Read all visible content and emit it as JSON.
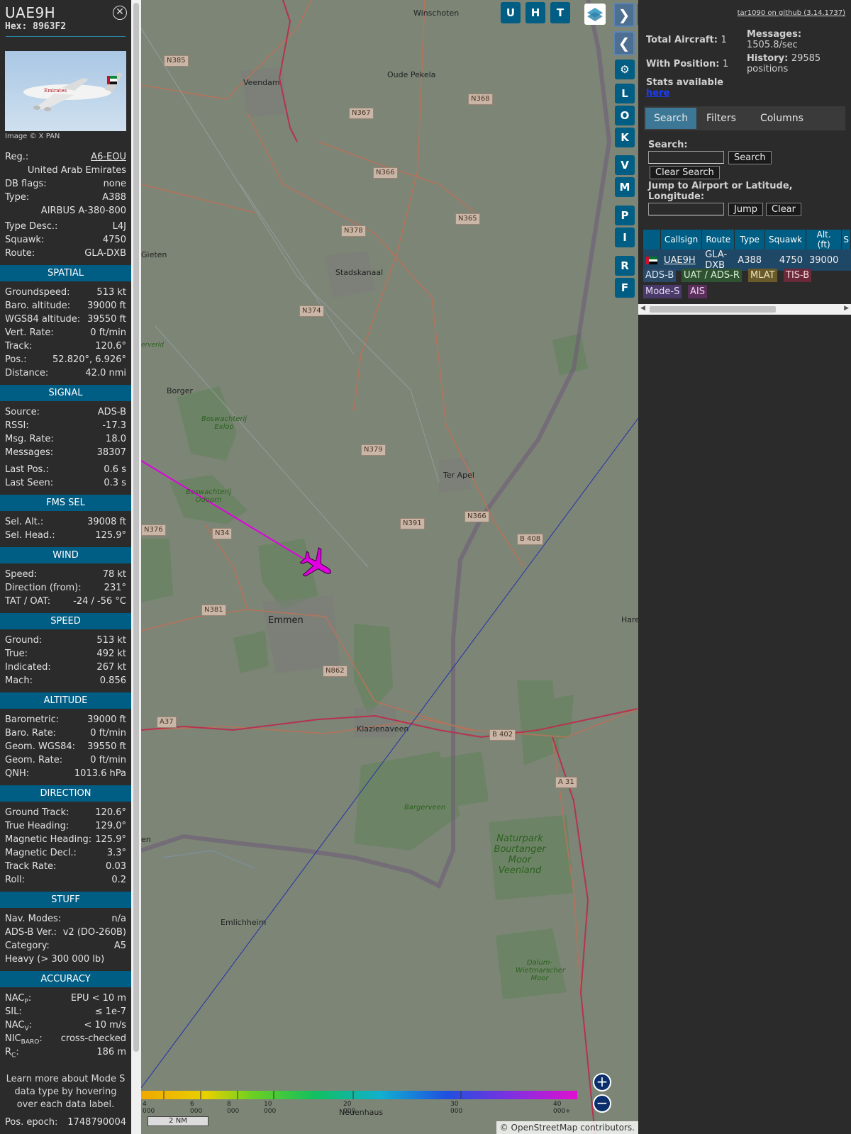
{
  "aircraft": {
    "callsign": "UAE9H",
    "hex_label": "Hex:",
    "hex": "8963F2",
    "image_credit": "Image © X PAN",
    "reg_label": "Reg.:",
    "reg": "A6-EOU",
    "country": "United Arab Emirates",
    "dbflags_label": "DB flags:",
    "dbflags": "none",
    "type_label": "Type:",
    "type": "A388",
    "type_full": "AIRBUS A-380-800",
    "typedesc_label": "Type Desc.:",
    "typedesc": "L4J",
    "squawk_label": "Squawk:",
    "squawk": "4750",
    "route_label": "Route:",
    "route": "GLA-DXB"
  },
  "sections": {
    "spatial": {
      "title": "SPATIAL",
      "rows": [
        {
          "l": "Groundspeed:",
          "v": "513 kt"
        },
        {
          "l": "Baro. altitude:",
          "v": "39000 ft"
        },
        {
          "l": "WGS84 altitude:",
          "v": "39550 ft"
        },
        {
          "l": "Vert. Rate:",
          "v": "0 ft/min"
        },
        {
          "l": "Track:",
          "v": "120.6°"
        },
        {
          "l": "Pos.:",
          "v": "52.820°, 6.926°"
        },
        {
          "l": "Distance:",
          "v": "42.0 nmi"
        }
      ]
    },
    "signal": {
      "title": "SIGNAL",
      "rows": [
        {
          "l": "Source:",
          "v": "ADS-B"
        },
        {
          "l": "RSSI:",
          "v": "-17.3"
        },
        {
          "l": "Msg. Rate:",
          "v": "18.0"
        },
        {
          "l": "Messages:",
          "v": "38307"
        },
        {
          "l": "Last Pos.:",
          "v": "0.6 s"
        },
        {
          "l": "Last Seen:",
          "v": "0.3 s"
        }
      ]
    },
    "fms": {
      "title": "FMS SEL",
      "rows": [
        {
          "l": "Sel. Alt.:",
          "v": "39008 ft"
        },
        {
          "l": "Sel. Head.:",
          "v": "125.9°"
        }
      ]
    },
    "wind": {
      "title": "WIND",
      "rows": [
        {
          "l": "Speed:",
          "v": "78 kt"
        },
        {
          "l": "Direction (from):",
          "v": "231°"
        },
        {
          "l": "TAT / OAT:",
          "v": "-24 / -56 °C"
        }
      ]
    },
    "speed": {
      "title": "SPEED",
      "rows": [
        {
          "l": "Ground:",
          "v": "513 kt"
        },
        {
          "l": "True:",
          "v": "492 kt"
        },
        {
          "l": "Indicated:",
          "v": "267 kt"
        },
        {
          "l": "Mach:",
          "v": "0.856"
        }
      ]
    },
    "altitude": {
      "title": "ALTITUDE",
      "rows": [
        {
          "l": "Barometric:",
          "v": "39000 ft"
        },
        {
          "l": "Baro. Rate:",
          "v": "0 ft/min"
        },
        {
          "l": "Geom. WGS84:",
          "v": "39550 ft"
        },
        {
          "l": "Geom. Rate:",
          "v": "0 ft/min"
        },
        {
          "l": "QNH:",
          "v": "1013.6 hPa"
        }
      ]
    },
    "direction": {
      "title": "DIRECTION",
      "rows": [
        {
          "l": "Ground Track:",
          "v": "120.6°"
        },
        {
          "l": "True Heading:",
          "v": "129.0°"
        },
        {
          "l": "Magnetic Heading:",
          "v": "125.9°"
        },
        {
          "l": "Magnetic Decl.:",
          "v": "3.3°"
        },
        {
          "l": "Track Rate:",
          "v": "0.03"
        },
        {
          "l": "Roll:",
          "v": "0.2"
        }
      ]
    },
    "stuff": {
      "title": "STUFF",
      "rows": [
        {
          "l": "Nav. Modes:",
          "v": "n/a"
        },
        {
          "l": "ADS-B Ver.:",
          "v": "v2 (DO-260B)"
        },
        {
          "l": "Category:",
          "v": "A5"
        }
      ],
      "category_desc": "Heavy (> 300 000 lb)"
    },
    "accuracy": {
      "title": "ACCURACY",
      "nacp_l": "NAC",
      "nacp_sub": "P",
      "nacp_v": "EPU < 10 m",
      "sil_l": "SIL:",
      "sil_v": "≤ 1e-7",
      "nacv_l": "NAC",
      "nacv_sub": "V",
      "nacv_v": "< 10 m/s",
      "nic_l": "NIC",
      "nic_sub": "BARO",
      "nic_v": "cross-checked",
      "rc_l": "R",
      "rc_sub": "C",
      "rc_v": "186 m"
    },
    "footnote": "Learn more about Mode S data type by hovering over each data label.",
    "epoch_label": "Pos. epoch:",
    "epoch": "1748790004"
  },
  "map": {
    "buttons": {
      "u": "U",
      "h": "H",
      "t": "T",
      "l": "L",
      "o": "O",
      "k": "K",
      "v": "V",
      "m": "M",
      "p": "P",
      "i": "I",
      "r": "R",
      "f": "F"
    },
    "towns": {
      "winschoten": "Winschoten",
      "veendam": "Veendam",
      "oude_pekela": "Oude Pekela",
      "gieten": "Gieten",
      "stadskanaal": "Stadskanaal",
      "borger": "Borger",
      "ter_apel": "Ter Apel",
      "emmen": "Emmen",
      "klazienaveen": "Klazienaveen",
      "emlichheim": "Emlichheim",
      "neuenhaus": "Neuenhaus",
      "hare": "Hare",
      "erverld": "erverld",
      "en": "en"
    },
    "roads": {
      "n385": "N385",
      "n367": "N367",
      "n368": "N368",
      "n366a": "N366",
      "n365": "N365",
      "n378": "N378",
      "n374": "N374",
      "n379": "N379",
      "n366b": "N366",
      "n391": "N391",
      "n376": "N376",
      "n34": "N34",
      "b408": "B 408",
      "n381": "N381",
      "n862": "N862",
      "a37": "A37",
      "b402": "B 402",
      "a31": "A 31"
    },
    "forests": {
      "exloo": "Boswachterij Exloo",
      "odoorn": "Boswachterij Odoorn",
      "bargerveen": "Bargerveen",
      "bourtanger": "Naturpark Bourtanger Moor Veenland",
      "dalum": "Dalum-Wietmarscher Moor"
    },
    "altitude_scale": [
      "4 000",
      "6 000",
      "8 000",
      "10 000",
      "20 000",
      "30 000",
      "40 000+"
    ],
    "scalebar": "2 NM",
    "attribution_symbol": "©",
    "attribution_link": "OpenStreetMap",
    "attribution_rest": "contributors.",
    "accent": "#005d84",
    "track_color": "#e000e0"
  },
  "right": {
    "github": "tar1090 on github (3.14.1737)",
    "total_aircraft_label": "Total Aircraft:",
    "total_aircraft": "1",
    "with_position_label": "With Position:",
    "with_position": "1",
    "messages_label": "Messages:",
    "messages": "1505.8/sec",
    "history_label": "History:",
    "history": "29585 positions",
    "stats_text": "Stats available",
    "stats_link": "here",
    "tabs": {
      "search": "Search",
      "filters": "Filters",
      "columns": "Columns"
    },
    "search_label": "Search:",
    "search_btn": "Search",
    "clear_search_btn": "Clear Search",
    "jump_label": "Jump to Airport or Latitude, Longitude:",
    "jump_btn": "Jump",
    "clear_btn": "Clear",
    "table_headers": [
      "Callsign",
      "Route",
      "Type",
      "Squawk",
      "Alt. (ft)",
      "S"
    ],
    "table_row": {
      "callsign": "UAE9H",
      "route": "GLA-DXB",
      "type": "A388",
      "squawk": "4750",
      "alt": "39000"
    },
    "source_tags": [
      "ADS-B",
      "UAT / ADS-R",
      "MLAT",
      "TIS-B",
      "Mode-S",
      "AIS"
    ]
  }
}
